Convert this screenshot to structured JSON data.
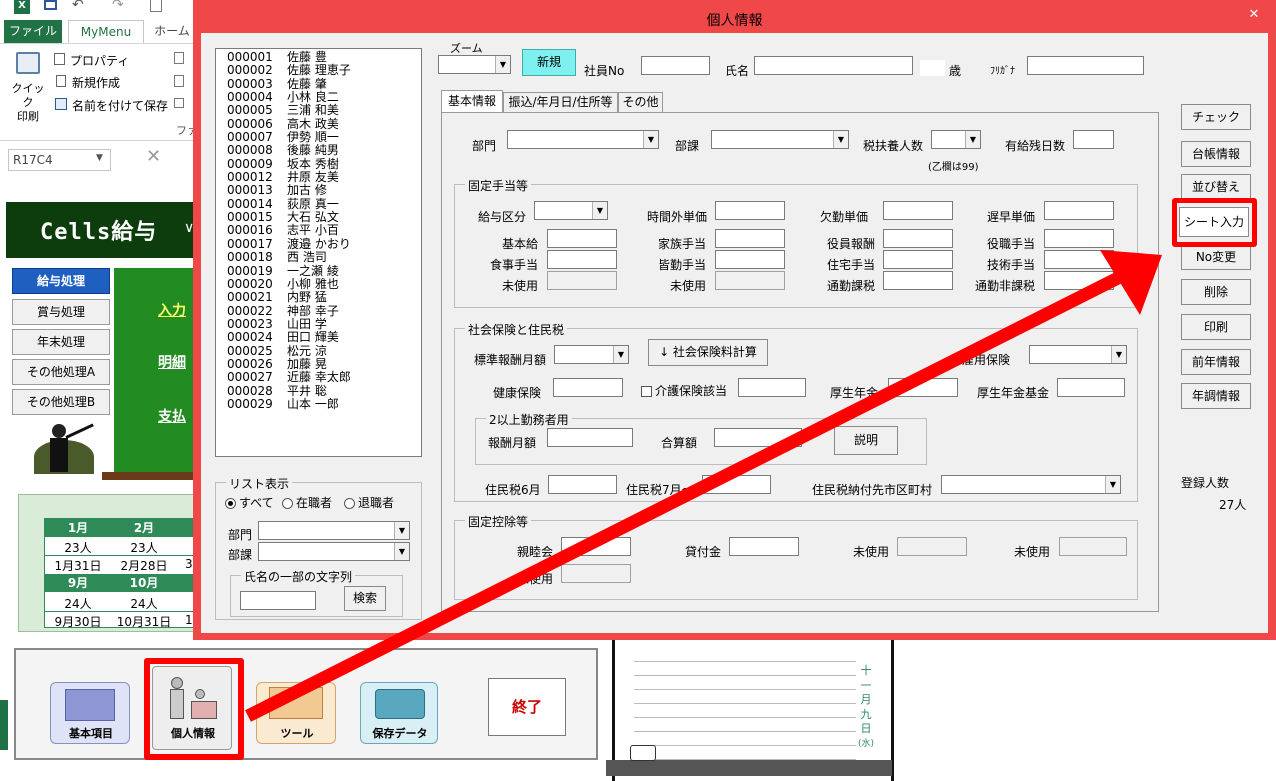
{
  "excel": {
    "ribbon_tabs": [
      "ファイル",
      "MyMenu",
      "ホーム"
    ],
    "quick_print_label": "クイック\n印刷",
    "menu_properties": "プロパティ",
    "menu_new": "新規作成",
    "menu_save_as": "名前を付けて保存",
    "group_label_fragment": "ファ",
    "name_box": "R17C4"
  },
  "cells_sheet": {
    "title": "Cells給与",
    "title_fragment": "∨",
    "menu_buttons": [
      "給与処理",
      "賞与処理",
      "年末処理",
      "その他処理A",
      "その他処理B"
    ],
    "links": [
      "入力",
      "明細",
      "支払"
    ],
    "calendar": {
      "months_row1": [
        "1月",
        "2月"
      ],
      "counts_row1": [
        "23人",
        "23人"
      ],
      "dates_row1": [
        "1月31日",
        "2月28日",
        "3"
      ],
      "months_row2": [
        "9月",
        "10月"
      ],
      "counts_row2": [
        "24人",
        "24人"
      ],
      "dates_row2": [
        "9月30日",
        "10月31日",
        "1"
      ]
    },
    "bottom_buttons": {
      "kihon": "基本項目",
      "kojin": "個人情報",
      "tool": "ツール",
      "hozon": "保存データ",
      "end": "終了"
    },
    "vertical_text": [
      "十",
      "一",
      "月",
      "九",
      "日",
      "(水)"
    ]
  },
  "dialog": {
    "title": "個人情報",
    "close_glyph": "✕",
    "employees": [
      {
        "no": "000001",
        "name": "佐藤 豊"
      },
      {
        "no": "000002",
        "name": "佐藤 理恵子"
      },
      {
        "no": "000003",
        "name": "佐藤 肇"
      },
      {
        "no": "000004",
        "name": "小林 良二"
      },
      {
        "no": "000005",
        "name": "三浦 和美"
      },
      {
        "no": "000006",
        "name": "高木 政美"
      },
      {
        "no": "000007",
        "name": "伊勢 順一"
      },
      {
        "no": "000008",
        "name": "後藤 純男"
      },
      {
        "no": "000009",
        "name": "坂本 秀樹"
      },
      {
        "no": "000012",
        "name": "井原 友美"
      },
      {
        "no": "000013",
        "name": "加古 修"
      },
      {
        "no": "000014",
        "name": "荻原 真一"
      },
      {
        "no": "000015",
        "name": "大石 弘文"
      },
      {
        "no": "000016",
        "name": "志平 小百"
      },
      {
        "no": "000017",
        "name": "渡邉 かおり"
      },
      {
        "no": "000018",
        "name": "西 浩司"
      },
      {
        "no": "000019",
        "name": "一之瀬 綾"
      },
      {
        "no": "000020",
        "name": "小柳 雅也"
      },
      {
        "no": "000021",
        "name": "内野 猛"
      },
      {
        "no": "000022",
        "name": "神部 幸子"
      },
      {
        "no": "000023",
        "name": "山田 学"
      },
      {
        "no": "000024",
        "name": "田口 輝美"
      },
      {
        "no": "000025",
        "name": "松元 涼"
      },
      {
        "no": "000026",
        "name": "加藤 晃"
      },
      {
        "no": "000027",
        "name": "近藤 幸太郎"
      },
      {
        "no": "000028",
        "name": "平井 聡"
      },
      {
        "no": "000029",
        "name": "山本 一郎"
      }
    ],
    "list_display": {
      "group_title": "リスト表示",
      "radio_all": "すべて",
      "radio_active": "在職者",
      "radio_retired": "退職者",
      "dept_label": "部門",
      "section_label": "部課",
      "name_search_title": "氏名の一部の文字列",
      "search_button": "検索"
    },
    "header": {
      "zoom_label": "ズーム",
      "new_button": "新規",
      "employee_no_label": "社員No",
      "name_label": "氏名",
      "age_unit": "歳",
      "furigana_label": "ﾌﾘｶﾞﾅ"
    },
    "tabs": [
      "基本情報",
      "振込/年月日/住所等",
      "その他"
    ],
    "basic": {
      "dept_label": "部門",
      "section_label": "部課",
      "dependents_label": "税扶養人数",
      "paid_leave_label": "有給残日数",
      "dependents_note": "(乙欄は99)"
    },
    "fixed_allowance": {
      "title": "固定手当等",
      "labels": {
        "pay_type": "給与区分",
        "overtime_rate": "時間外単価",
        "absence_rate": "欠勤単価",
        "late_rate": "遅早単価",
        "base_pay": "基本給",
        "family_allowance": "家族手当",
        "officer_pay": "役員報酬",
        "position_allowance": "役職手当",
        "meal_allowance": "食事手当",
        "attendance_allowance": "皆勤手当",
        "housing_allowance": "住宅手当",
        "skill_allowance": "技術手当",
        "unused1": "未使用",
        "unused2": "未使用",
        "commute_taxable": "通勤課税",
        "commute_nontaxable": "通勤非課税"
      }
    },
    "social": {
      "title": "社会保険と住民税",
      "standard_monthly": "標準報酬月額",
      "calc_button": "↓ 社会保険料計算",
      "employment_ins": "雇用保険",
      "health_ins": "健康保険",
      "care_ins": "介護保険該当",
      "pension": "厚生年金",
      "pension_fund": "厚生年金基金",
      "multi_title": "2以上勤務者用",
      "monthly_pay": "報酬月額",
      "total_amount": "合算額",
      "explain_button": "説明",
      "resident_tax_june": "住民税6月",
      "resident_tax_july": "住民税7月～",
      "resident_tax_city": "住民税納付先市区町村"
    },
    "deduction": {
      "title": "固定控除等",
      "friendship": "親睦会",
      "loan": "貸付金",
      "unused1": "未使用",
      "unused2": "未使用",
      "unused3": "未使用"
    },
    "right_buttons": [
      "チェック",
      "台帳情報",
      "並び替え",
      "シート入力",
      "No変更",
      "削除",
      "印刷",
      "前年情報",
      "年調情報"
    ],
    "registered_label": "登録人数",
    "registered_count": "27人"
  },
  "colors": {
    "dialog_frame": "#f04848",
    "highlight": "#ff0000",
    "sheet_green": "#0d3d0d",
    "menu_green": "#228b22",
    "calendar_green": "#2e8b57"
  }
}
